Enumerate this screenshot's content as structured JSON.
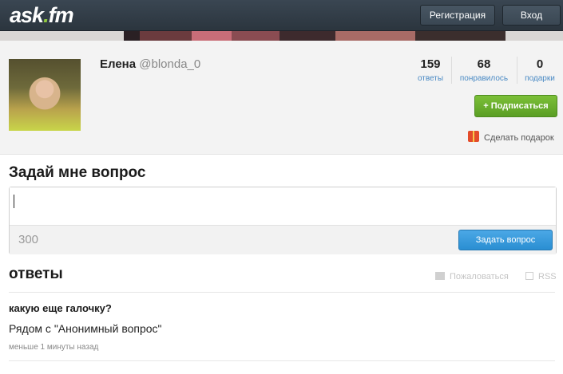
{
  "header": {
    "logo_main": "ask",
    "logo_dot": ".",
    "logo_tld": "fm",
    "register_label": "Регистрация",
    "login_label": "Вход"
  },
  "profile": {
    "name": "Елена",
    "username": "@blonda_0",
    "stats": [
      {
        "value": "159",
        "label": "ответы"
      },
      {
        "value": "68",
        "label": "понравилось"
      },
      {
        "value": "0",
        "label": "подарки"
      }
    ],
    "subscribe_label": "+ Подписаться",
    "gift_label": "Сделать подарок"
  },
  "ask": {
    "title": "Задай мне вопрос",
    "input_value": "",
    "char_counter": "300",
    "submit_label": "Задать вопрос"
  },
  "answers": {
    "title": "ответы",
    "report_label": "Пожаловаться",
    "rss_label": "RSS",
    "items": [
      {
        "question": "какую еще галочку?",
        "answer": "Рядом с \"Анонимный вопрос\"",
        "time": "меньше 1 минуты назад"
      }
    ]
  },
  "colors": {
    "topbar": "#2f3a44",
    "accent_green": "#6bb02e",
    "accent_blue": "#3a9ad9",
    "link_blue": "#4a8ac4"
  }
}
